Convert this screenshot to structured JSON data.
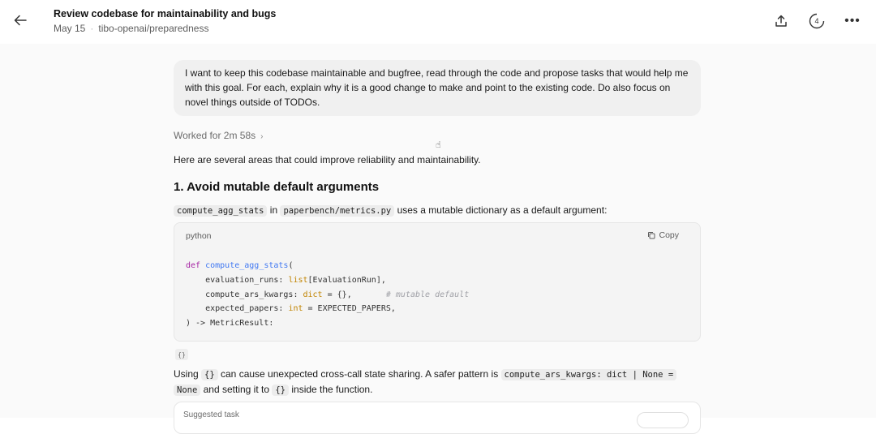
{
  "header": {
    "title": "Review codebase for maintainability and bugs",
    "date": "May 15",
    "repo": "tibo-openai/preparedness",
    "badge_count": "4"
  },
  "conversation": {
    "user_message": "I want to keep this codebase maintainable and bugfree, read through the code and propose tasks that would help me with this goal. For each, explain why it is a good change to make and point to the existing code. Do also focus on novel things outside of TODOs.",
    "worked_for": "Worked for 2m 58s",
    "intro": "Here are several areas that could improve reliability and maintainability.",
    "section_heading": "1. Avoid mutable default arguments",
    "para1": {
      "code1": "compute_agg_stats",
      "t1": " in ",
      "code2": "paperbench/metrics.py",
      "t2": " uses a mutable dictionary as a default argument:"
    },
    "codeblock": {
      "language": "python",
      "copy_label": "Copy"
    },
    "para2": {
      "t1": "Using ",
      "code1": "{}",
      "t2": " can cause unexpected cross-call state sharing. A safer pattern is ",
      "code2a": "compute_ars_kwargs: dict | None =",
      "code2b": "None",
      "t3": " and setting it to ",
      "code3": "{}",
      "t4": " inside the function."
    },
    "suggested_task_label": "Suggested task"
  }
}
